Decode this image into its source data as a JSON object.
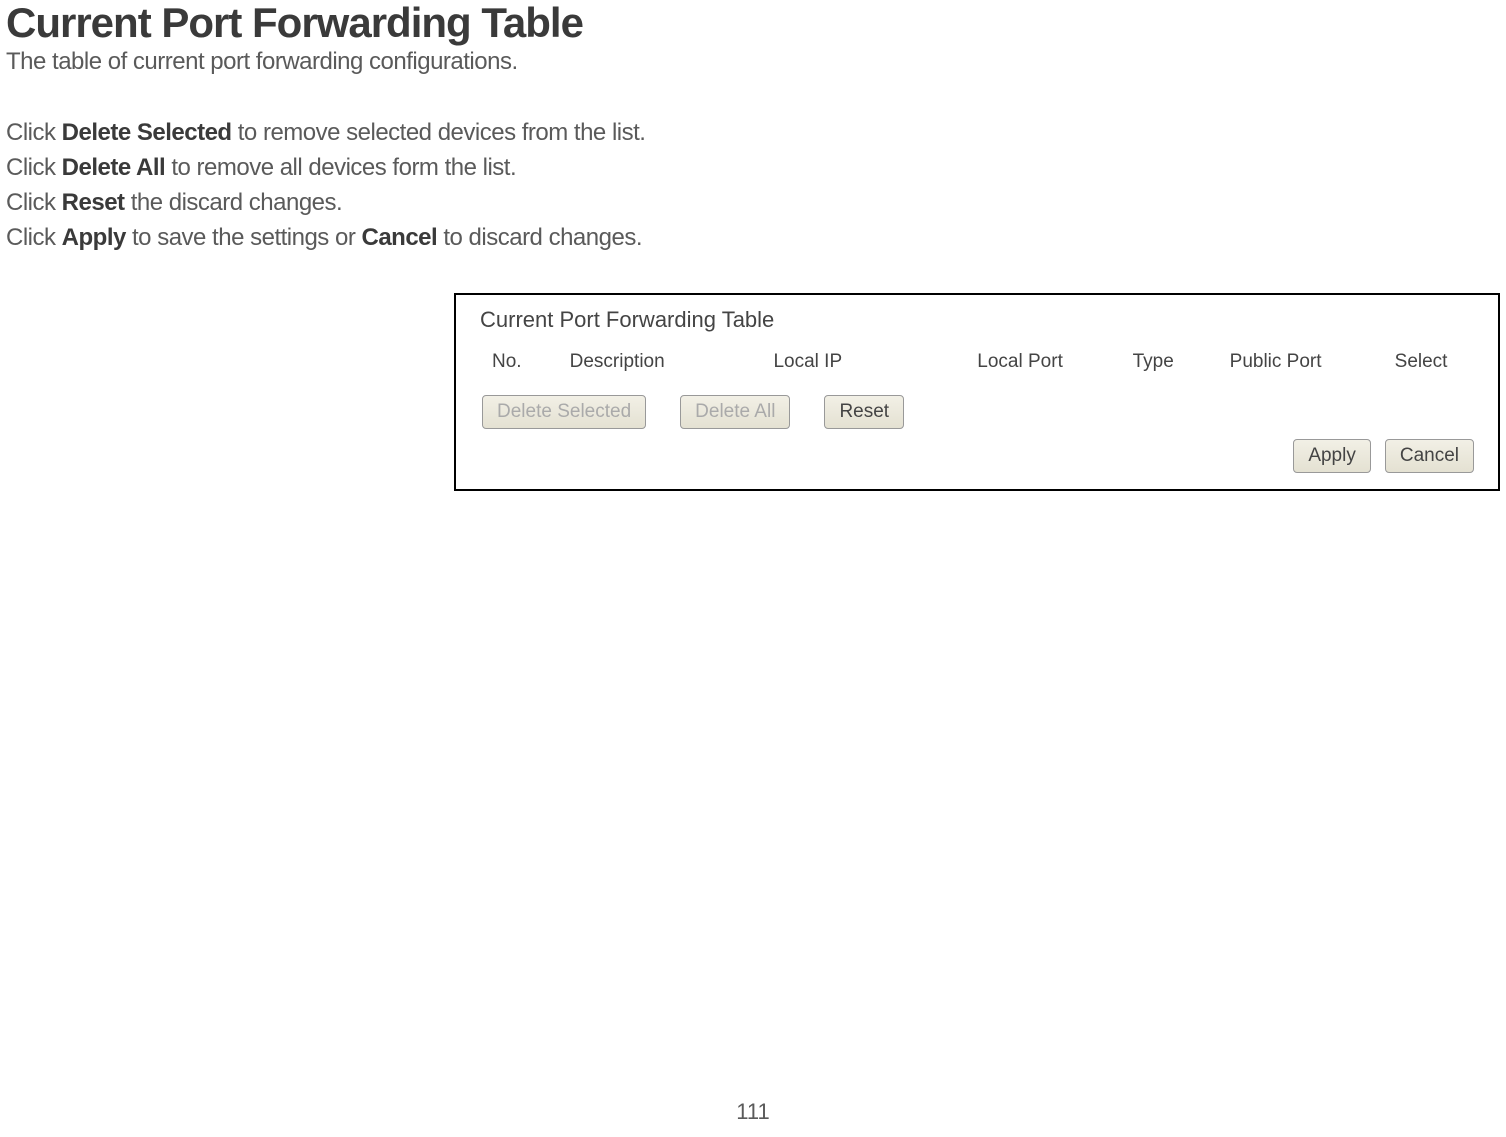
{
  "header": {
    "title": "Current Port Forwarding Table",
    "subtitle": "The table of current port forwarding configurations."
  },
  "instructions": {
    "line1_prefix": "Click ",
    "line1_bold": "Delete Selected",
    "line1_suffix": " to remove selected devices from the list.",
    "line2_prefix": "Click ",
    "line2_bold": "Delete All",
    "line2_suffix": " to remove all devices form the list.",
    "line3_prefix": "Click ",
    "line3_bold": "Reset",
    "line3_suffix": " the discard changes.",
    "line4_prefix": "Click ",
    "line4_bold1": "Apply",
    "line4_mid": " to save the settings or ",
    "line4_bold2": "Cancel",
    "line4_suffix": " to discard changes."
  },
  "panel": {
    "title": "Current Port Forwarding Table",
    "columns": {
      "no": "No.",
      "description": "Description",
      "local_ip": "Local IP",
      "local_port": "Local Port",
      "type": "Type",
      "public_port": "Public Port",
      "select": "Select"
    },
    "buttons": {
      "delete_selected": "Delete Selected",
      "delete_all": "Delete All",
      "reset": "Reset",
      "apply": "Apply",
      "cancel": "Cancel"
    }
  },
  "page_number": "111"
}
